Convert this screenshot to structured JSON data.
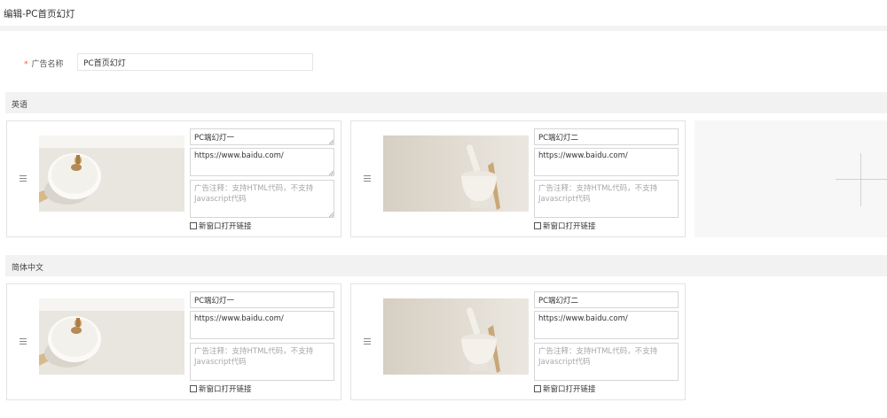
{
  "page": {
    "title": "编辑-PC首页幻灯"
  },
  "ad_name": {
    "required_mark": "*",
    "label": "广告名称",
    "value": "PC首页幻灯"
  },
  "sections": [
    {
      "label": "英语",
      "slides": [
        {
          "title": "PC端幻灯一",
          "url": "https://www.baidu.com/",
          "note_placeholder": "广告注释：支持HTML代码，不支持Javascript代码",
          "new_window_label": "新窗口打开链接",
          "image": "teapot-lid-photo"
        },
        {
          "title": "PC端幻灯二",
          "url": "https://www.baidu.com/",
          "note_placeholder": "广告注释：支持HTML代码，不支持Javascript代码",
          "new_window_label": "新窗口打开链接",
          "image": "mortar-pestle-photo"
        }
      ],
      "add_icon": "plus-icon"
    },
    {
      "label": "简体中文",
      "slides": [
        {
          "title": "PC端幻灯一",
          "url": "https://www.baidu.com/",
          "note_placeholder": "广告注释：支持HTML代码，不支持Javascript代码",
          "new_window_label": "新窗口打开链接",
          "image": "teapot-lid-photo"
        },
        {
          "title": "PC端幻灯二",
          "url": "https://www.baidu.com/",
          "note_placeholder": "广告注释：支持HTML代码，不支持Javascript代码",
          "new_window_label": "新窗口打开链接",
          "image": "mortar-pestle-photo"
        }
      ]
    }
  ],
  "colors": {
    "required": "#ff5a1f",
    "section_bg": "#f2f2f2",
    "border": "#e3e3e3"
  }
}
